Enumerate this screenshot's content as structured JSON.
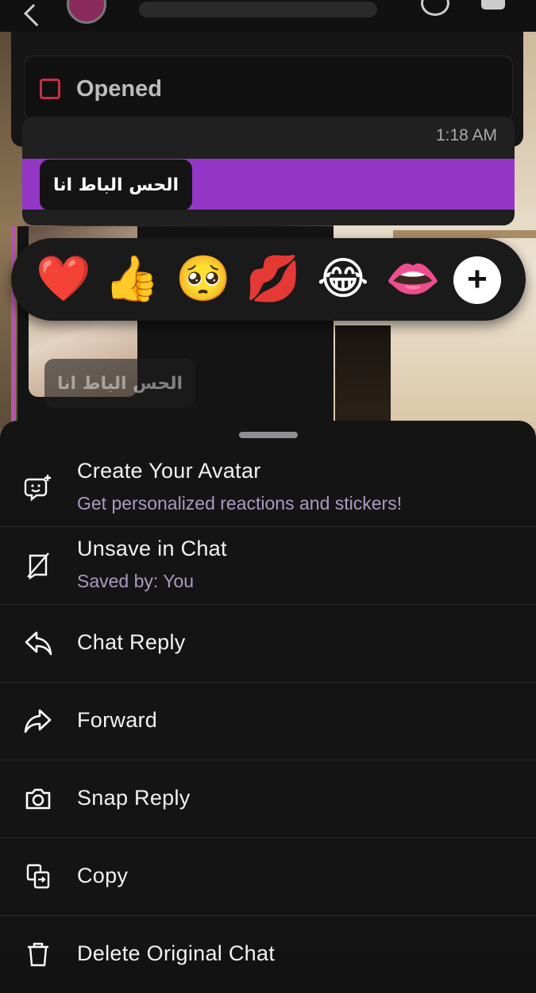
{
  "status": {
    "label": "Opened"
  },
  "message": {
    "timestamp": "1:18 AM",
    "text": "الحس الباط انا",
    "quoted_text": "الحس الباط انا"
  },
  "reactions": [
    {
      "icon": "red-heart-emoji",
      "glyph": "❤️"
    },
    {
      "icon": "thumbs-up-emoji",
      "glyph": "👍"
    },
    {
      "icon": "pleading-face-emoji",
      "glyph": "🥺"
    },
    {
      "icon": "kiss-mark-emoji",
      "glyph": "💋"
    },
    {
      "icon": "tears-of-joy-emoji",
      "glyph": "😂"
    },
    {
      "icon": "lips-emoji",
      "glyph": "👄"
    }
  ],
  "reaction_more": {
    "icon": "plus-icon",
    "glyph": "+"
  },
  "menu": {
    "create_avatar": {
      "title": "Create Your Avatar",
      "subtitle": "Get personalized reactions and stickers!"
    },
    "unsave": {
      "title": "Unsave in Chat",
      "subtitle": "Saved by: You"
    },
    "chat_reply": {
      "title": "Chat Reply"
    },
    "forward": {
      "title": "Forward"
    },
    "snap_reply": {
      "title": "Snap Reply"
    },
    "copy": {
      "title": "Copy"
    },
    "delete": {
      "title": "Delete Original Chat"
    }
  },
  "colors": {
    "accent_purple": "#9437c6",
    "opened_red": "#c62f44",
    "subtitle_lavender": "#a99bc0",
    "sheet_bg": "#141414"
  }
}
